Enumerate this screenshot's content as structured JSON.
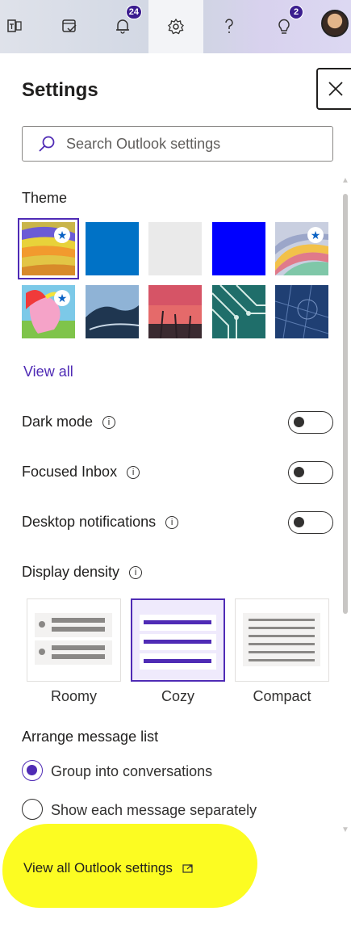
{
  "topbar": {
    "notifications_count": "24",
    "tips_count": "2"
  },
  "panel": {
    "title": "Settings",
    "search_placeholder": "Search Outlook settings"
  },
  "theme": {
    "label": "Theme",
    "view_all": "View all",
    "tiles": [
      {
        "name": "rainbow-swirl",
        "selected": true,
        "premium": true
      },
      {
        "name": "blue",
        "color": "#0072c6"
      },
      {
        "name": "light-gray",
        "color": "#eaeaea"
      },
      {
        "name": "bright-blue",
        "color": "#0000ff"
      },
      {
        "name": "colorful-waves",
        "premium": true
      },
      {
        "name": "unicorn-art",
        "premium": true
      },
      {
        "name": "mountain-landscape"
      },
      {
        "name": "palm-sunset"
      },
      {
        "name": "circuit-board"
      },
      {
        "name": "blueprint"
      }
    ]
  },
  "toggles": {
    "dark_mode": "Dark mode",
    "focused_inbox": "Focused Inbox",
    "desktop_notifications": "Desktop notifications"
  },
  "density": {
    "label": "Display density",
    "options": [
      "Roomy",
      "Cozy",
      "Compact"
    ],
    "selected": "Cozy"
  },
  "arrange": {
    "label": "Arrange message list",
    "options": [
      "Group into conversations",
      "Show each message separately"
    ],
    "selected": "Group into conversations"
  },
  "footer": {
    "view_all_settings": "View all Outlook settings"
  },
  "colors": {
    "accent": "#4f2bb5",
    "highlight": "#fcfc22",
    "badge": "#3b1d8f"
  }
}
